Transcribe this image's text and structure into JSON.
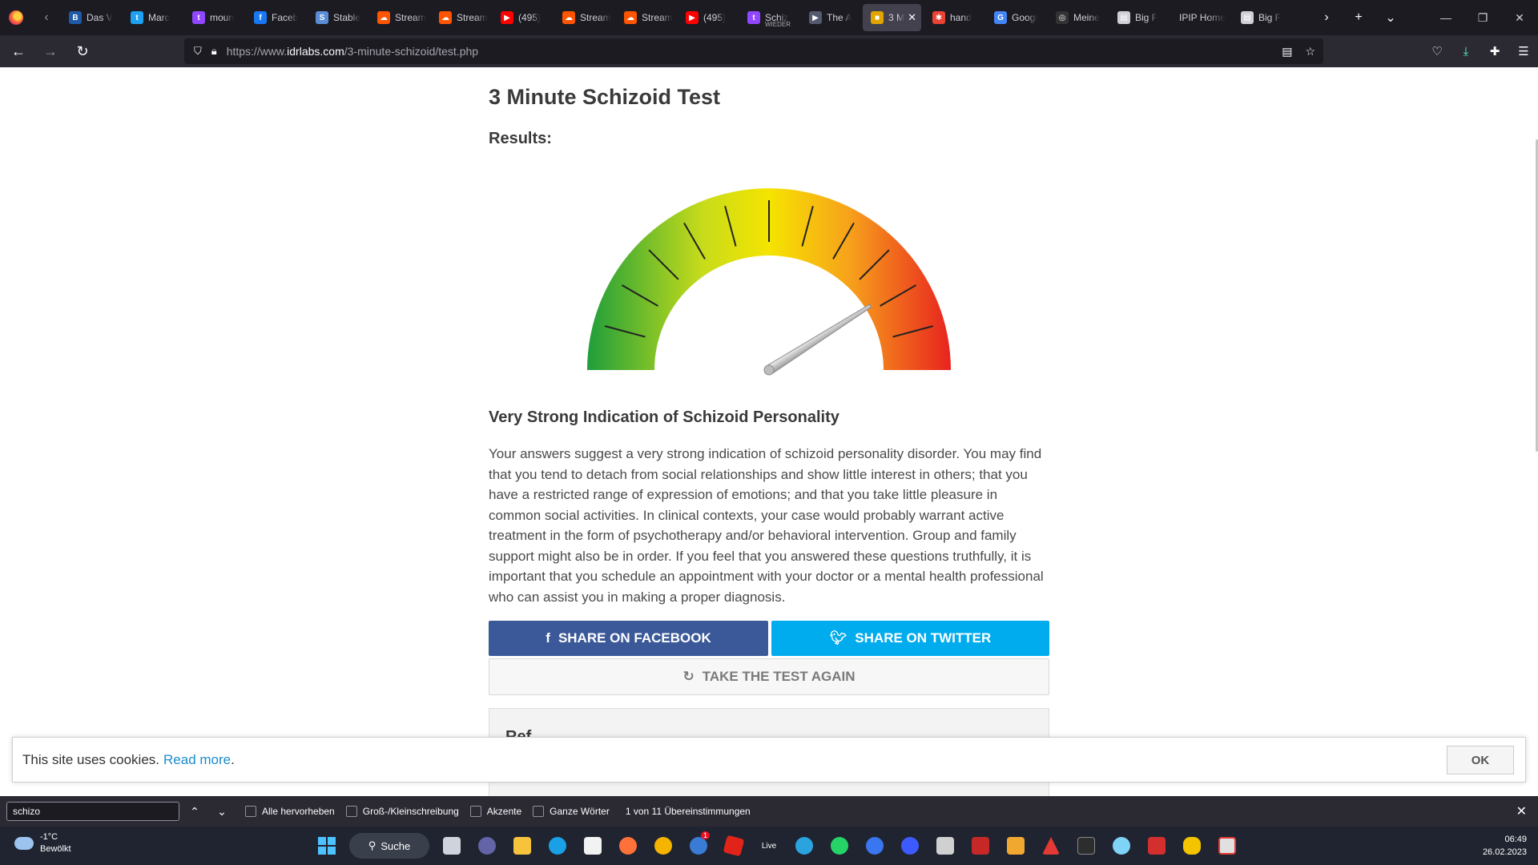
{
  "browser": {
    "tabs": [
      {
        "label": "Das V",
        "icon": "bs-icon",
        "color": "#1e5aa8",
        "glyph": "B"
      },
      {
        "label": "Marc",
        "icon": "twitter-icon",
        "color": "#1da1f2",
        "glyph": "t"
      },
      {
        "label": "moun",
        "icon": "twitch-icon",
        "color": "#9146ff",
        "glyph": "t"
      },
      {
        "label": "Faceb",
        "icon": "facebook-icon",
        "color": "#1877f2",
        "glyph": "f"
      },
      {
        "label": "Stable",
        "icon": "stable-icon",
        "color": "#5a8dd6",
        "glyph": "S"
      },
      {
        "label": "Stream",
        "icon": "soundcloud-icon",
        "color": "#ff5500",
        "glyph": "☁"
      },
      {
        "label": "Stream",
        "icon": "soundcloud-icon",
        "color": "#ff5500",
        "glyph": "☁"
      },
      {
        "label": "(495)",
        "icon": "youtube-icon",
        "color": "#ff0000",
        "glyph": "▶"
      },
      {
        "label": "Stream",
        "icon": "soundcloud-icon",
        "color": "#ff5500",
        "glyph": "☁"
      },
      {
        "label": "Stream",
        "icon": "soundcloud-icon",
        "color": "#ff5500",
        "glyph": "☁"
      },
      {
        "label": "(495)",
        "icon": "youtube-icon",
        "color": "#ff0000",
        "glyph": "▶"
      },
      {
        "label": "Schiz",
        "sublabel": "WIEDER",
        "icon": "twitch-icon",
        "color": "#9146ff",
        "glyph": "t"
      },
      {
        "label": "The A",
        "icon": "page-icon",
        "color": "#555b6e",
        "glyph": "▶"
      },
      {
        "label": "3 M",
        "icon": "idrlabs-icon",
        "color": "#e2a400",
        "glyph": "■",
        "active": true
      },
      {
        "label": "hand",
        "icon": "pinwheel-icon",
        "color": "#ea4335",
        "glyph": "✱"
      },
      {
        "label": "Googl",
        "icon": "google-icon",
        "color": "#4285f4",
        "glyph": "G"
      },
      {
        "label": "Meine",
        "icon": "globe-icon",
        "color": "#333333",
        "glyph": "◎"
      },
      {
        "label": "Big F",
        "icon": "doc-icon",
        "color": "#cfcfd8",
        "glyph": "▤"
      },
      {
        "label": "IPIP Home",
        "icon": "none",
        "color": "transparent",
        "glyph": ""
      },
      {
        "label": "Big F",
        "icon": "doc-icon",
        "color": "#cfcfd8",
        "glyph": "▤"
      }
    ],
    "url_prefix": "https://www.",
    "url_domain": "idrlabs.com",
    "url_path": "/3-minute-schizoid/test.php"
  },
  "page": {
    "title": "3 Minute Schizoid Test",
    "results_label": "Results:",
    "verdict": "Very Strong Indication of Schizoid Personality",
    "description": "Your answers suggest a very strong indication of schizoid personality disorder. You may find that you tend to detach from social relationships and show little interest in others; that you have a restricted range of expression of emotions; and that you take little pleasure in common social activities. In clinical contexts, your case would probably warrant active treatment in the form of psychotherapy and/or behavioral intervention. Group and family support might also be in order. If you feel that you answered these questions truthfully, it is important that you schedule an appointment with your doctor or a mental health professional who can assist you in making a proper diagnosis.",
    "share_facebook": "SHARE ON FACEBOOK",
    "share_twitter": "SHARE ON TWITTER",
    "take_again": "TAKE THE TEST AGAIN",
    "references_heading": "Ref",
    "gauge": {
      "value_fraction": 0.82,
      "colors": [
        "#1e9e3a",
        "#c8dc1a",
        "#f5e400",
        "#f7a21b",
        "#e8231f"
      ]
    }
  },
  "cookie": {
    "text": "This site uses cookies.",
    "link": "Read more",
    "period": ".",
    "ok": "OK"
  },
  "findbar": {
    "query": "schizo",
    "highlight_all": "Alle hervorheben",
    "match_case": "Groß-/Kleinschreibung",
    "accents": "Akzente",
    "whole_words": "Ganze Wörter",
    "status": "1 von 11 Übereinstimmungen"
  },
  "taskbar": {
    "temperature": "-1°C",
    "weather": "Bewölkt",
    "search": "Suche",
    "time": "06:49",
    "date": "26.02.2023",
    "badge_chat": "1",
    "live_label": "Live"
  }
}
